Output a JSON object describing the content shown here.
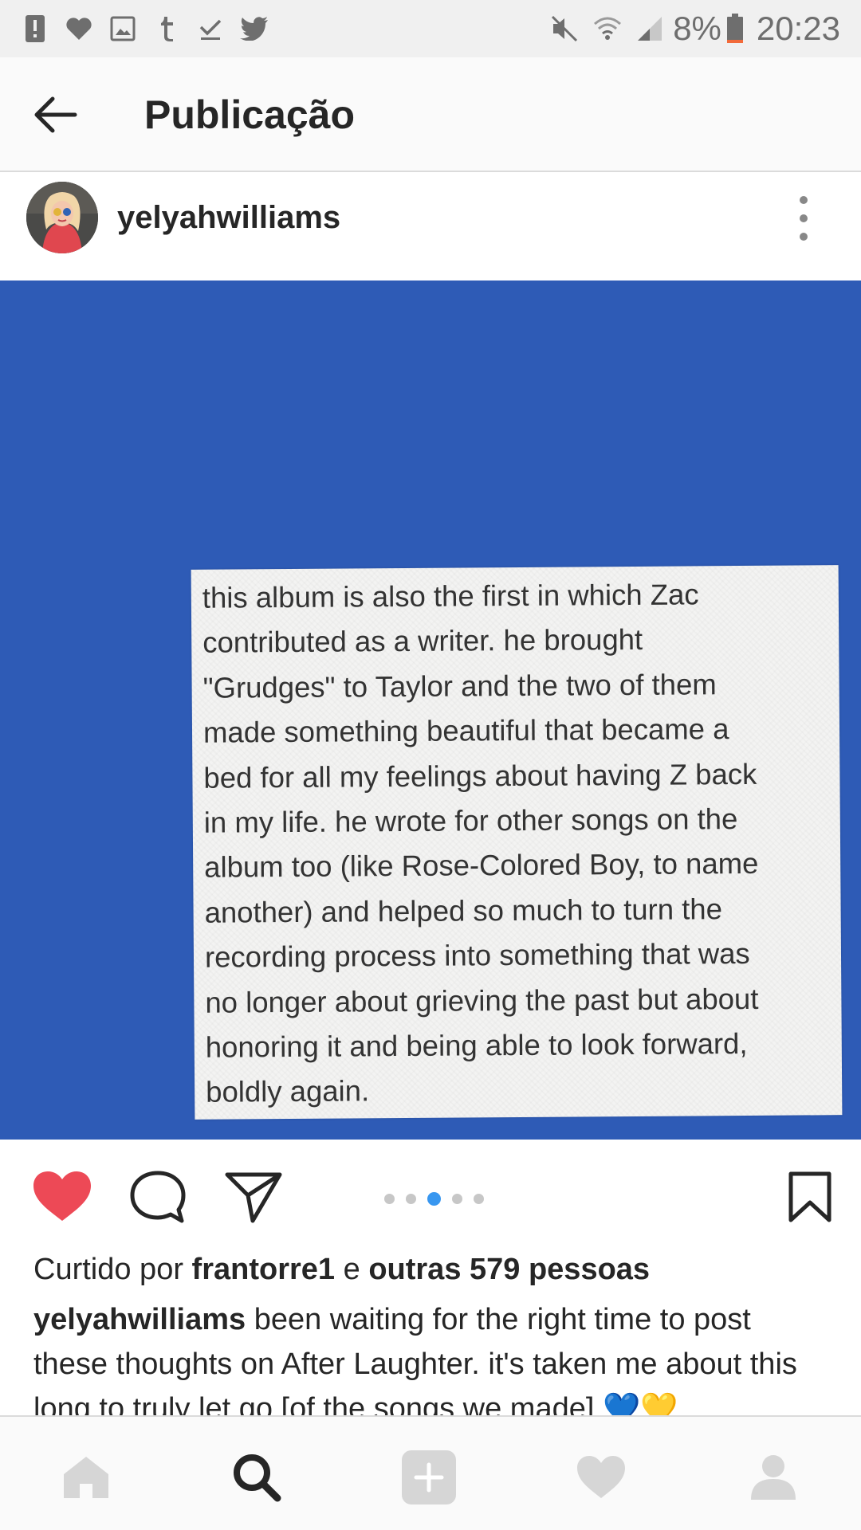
{
  "status_bar": {
    "battery_percent": "8%",
    "time": "20:23",
    "left_icons": [
      "alert-icon",
      "heart-icon",
      "image-icon",
      "tumblr-icon",
      "download-done-icon",
      "twitter-icon"
    ],
    "right_icons": [
      "mute-icon",
      "wifi-icon",
      "signal-icon",
      "battery-icon"
    ],
    "battery_color": "#f26a3a"
  },
  "app_bar": {
    "title": "Publicação"
  },
  "post": {
    "username": "yelyahwilliams",
    "image_background": "#2e5bb6",
    "image_text": "this album is also the first in which Zac\ncontributed as a writer. he brought\n\"Grudges\" to Taylor and the two of them\nmade something beautiful that became a\nbed for all my feelings about having Z back\nin my life. he wrote for other songs on the\nalbum too (like Rose-Colored Boy, to name\nanother) and helped so much to turn the\nrecording process into something that was\nno longer about grieving the past but about\nhonoring it and being able to look forward,\nboldly again.",
    "carousel": {
      "count": 5,
      "active_index": 2
    },
    "liked": true,
    "like_color": "#ed4956",
    "likes": {
      "prefix": "Curtido por",
      "user": "frantorre1",
      "connector": "e",
      "others": "outras 579 pessoas"
    },
    "caption": {
      "username": "yelyahwilliams",
      "text": "been waiting for the right time to post these thoughts on After Laughter. it's taken me about this long to truly let go [of the songs we made] 💙💛"
    }
  },
  "bottom_nav": {
    "items": [
      "home-icon",
      "search-icon",
      "add-icon",
      "activity-icon",
      "profile-icon"
    ],
    "active": "search-icon"
  }
}
